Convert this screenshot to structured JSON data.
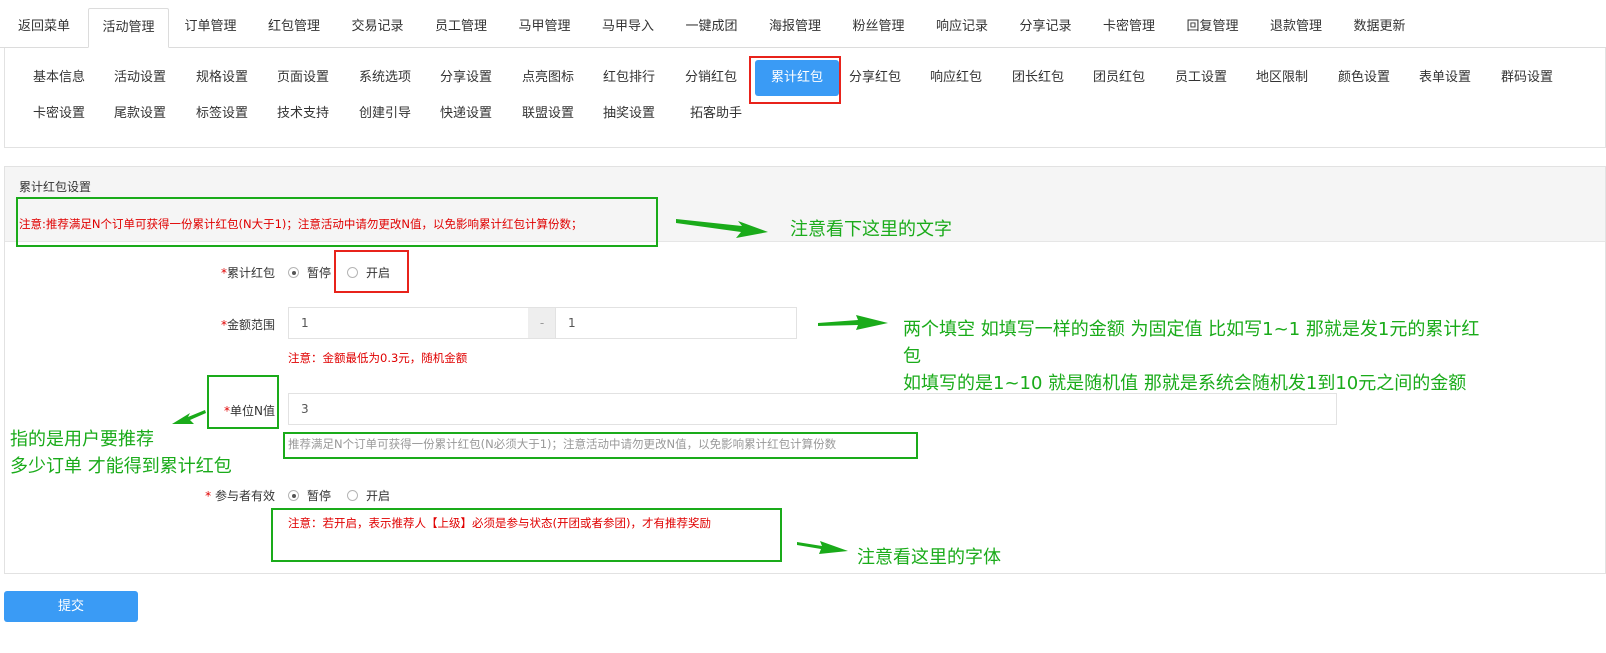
{
  "top_tabs": [
    "返回菜单",
    "活动管理",
    "订单管理",
    "红包管理",
    "交易记录",
    "员工管理",
    "马甲管理",
    "马甲导入",
    "一键成团",
    "海报管理",
    "粉丝管理",
    "响应记录",
    "分享记录",
    "卡密管理",
    "回复管理",
    "退款管理",
    "数据更新"
  ],
  "top_tabs_active": "活动管理",
  "sub_tabs_row1": [
    "基本信息",
    "活动设置",
    "规格设置",
    "页面设置",
    "系统选项",
    "分享设置",
    "点亮图标",
    "红包排行",
    "分销红包",
    "累计红包",
    "分享红包",
    "响应红包",
    "团长红包",
    "团员红包",
    "员工设置",
    "地区限制",
    "颜色设置",
    "表单设置",
    "群码设置"
  ],
  "sub_tabs_row2": [
    "卡密设置",
    "尾款设置",
    "标签设置",
    "技术支持",
    "创建引导",
    "快递设置",
    "联盟设置",
    "抽奖设置",
    "拓客助手"
  ],
  "sub_tabs_active": "累计红包",
  "panel": {
    "title": "累计红包设置",
    "notice": "注意:推荐满足N个订单可获得一份累计红包(N大于1)；注意活动中请勿更改N值，以免影响累计红包计算份数；"
  },
  "form": {
    "accumulate": {
      "required_mark": "*",
      "label": "累计红包",
      "options": [
        "暂停",
        "开启"
      ],
      "selected": "暂停"
    },
    "amount": {
      "required_mark": "*",
      "label": "金额范围",
      "min_value": "1",
      "separator": "-",
      "max_value": "1",
      "hint": "注意：金额最低为0.3元，随机金额"
    },
    "n_value": {
      "required_mark": "*",
      "label": "单位N值",
      "value": "3",
      "hint": "推荐满足N个订单可获得一份累计红包(N必须大于1)；注意活动中请勿更改N值，以免影响累计红包计算份数"
    },
    "participant": {
      "required_mark": "* ",
      "label": "参与者有效",
      "options": [
        "暂停",
        "开启"
      ],
      "selected": "暂停",
      "hint": "注意：若开启，表示推荐人【上级】必须是参与状态(开团或者参团)，才有推荐奖励"
    }
  },
  "submit_label": "提交",
  "annotations": {
    "notice_text": "注意看下这里的文字",
    "amount_line1": "两个填空 如填写一样的金额 为固定值 比如写1~1  那就是发1元的累计红",
    "amount_line2": "包",
    "amount_line3": "如填写的是1~10 就是随机值 那就是系统会随机发1到10元之间的金额",
    "n_line1": "指的是用户要推荐",
    "n_line2": "多少订单 才能得到累计红包",
    "font_text": "注意看这里的字体"
  },
  "colors": {
    "primary": "#3a9bf5",
    "annotation_green": "#1aab1a",
    "annotation_red": "#e8231b",
    "warning_red": "#e00000"
  }
}
